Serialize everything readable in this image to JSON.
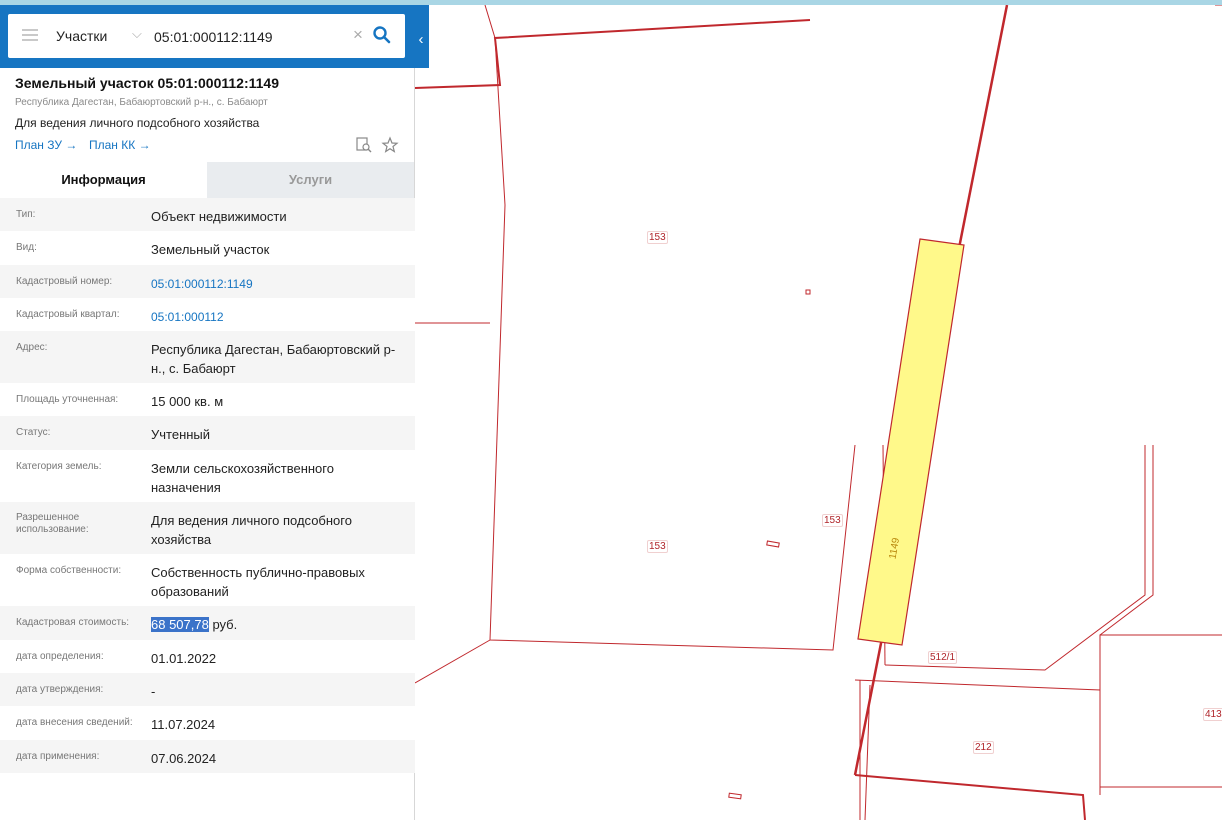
{
  "search": {
    "type_label": "Участки",
    "query": "05:01:000112:1149"
  },
  "header": {
    "title": "Земельный участок 05:01:000112:1149",
    "address": "Республика Дагестан, Бабаюртовский р-н., с. Бабаюрт",
    "purpose": "Для ведения личного подсобного хозяйства",
    "link_plan_zu": "План ЗУ",
    "link_plan_kk": "План КК"
  },
  "tabs": [
    {
      "label": "Информация",
      "active": true
    },
    {
      "label": "Услуги",
      "active": false
    }
  ],
  "info": [
    {
      "label": "Тип:",
      "value": "Объект недвижимости"
    },
    {
      "label": "Вид:",
      "value": "Земельный участок"
    },
    {
      "label": "Кадастровый номер:",
      "value": "05:01:000112:1149"
    },
    {
      "label": "Кадастровый квартал:",
      "value": "05:01:000112"
    },
    {
      "label": "Адрес:",
      "value": "Республика Дагестан, Бабаюртовский р-н., с. Бабаюрт"
    },
    {
      "label": "Площадь уточненная:",
      "value": "15 000 кв. м"
    },
    {
      "label": "Статус:",
      "value": "Учтенный"
    },
    {
      "label": "Категория земель:",
      "value": "Земли сельскохозяйственного назначения"
    },
    {
      "label": "Разрешенное использование:",
      "value": "Для ведения личного подсобного хозяйства"
    },
    {
      "label": "Форма собственности:",
      "value": "Собственность публично-правовых образований"
    },
    {
      "label": "Кадастровая стоимость:",
      "value_amount": "68 507,78",
      "value_unit": " руб."
    },
    {
      "label": "дата определения:",
      "value": "01.01.2022"
    },
    {
      "label": "дата утверждения:",
      "value": "-"
    },
    {
      "label": "дата внесения сведений:",
      "value": "11.07.2024"
    },
    {
      "label": "дата применения:",
      "value": "07.06.2024"
    }
  ],
  "map": {
    "labels": [
      "153",
      "153",
      "153",
      "1149",
      "512/1",
      "212",
      "413"
    ],
    "parcel_color": "#fff98a",
    "boundary_color": "#c0282d"
  }
}
